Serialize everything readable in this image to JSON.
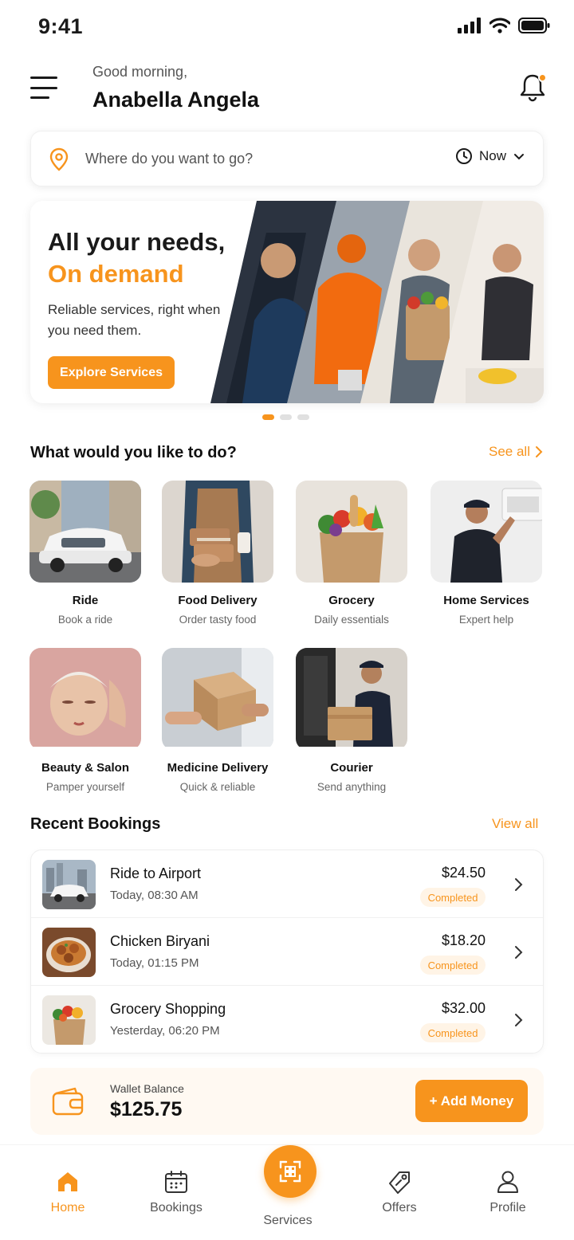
{
  "status_bar": {
    "time": "9:41"
  },
  "header": {
    "greeting": "Good morning,",
    "user_name": "Anabella Angela"
  },
  "search": {
    "placeholder": "Where do you want to go?",
    "time_option": "Now"
  },
  "hero": {
    "title_line1": "All your needs,",
    "title_line2": "On demand",
    "subtitle": "Reliable services, right when you need them.",
    "cta": "Explore Services"
  },
  "services_section": {
    "title": "What would you like to do?",
    "see_all": "See all"
  },
  "services": [
    {
      "name": "Ride",
      "desc": "Book a ride"
    },
    {
      "name": "Food Delivery",
      "desc": "Order tasty food"
    },
    {
      "name": "Grocery",
      "desc": "Daily essentials"
    },
    {
      "name": "Home Services",
      "desc": "Expert help"
    },
    {
      "name": "Beauty & Salon",
      "desc": "Pamper yourself"
    },
    {
      "name": "Medicine Delivery",
      "desc": "Quick & reliable"
    },
    {
      "name": "Courier",
      "desc": "Send anything"
    }
  ],
  "bookings_section": {
    "title": "Recent Bookings",
    "view_all": "View all"
  },
  "bookings": [
    {
      "title": "Ride to Airport",
      "time": "Today, 08:30 AM",
      "amount": "$24.50",
      "status": "Completed"
    },
    {
      "title": "Chicken Biryani",
      "time": "Today, 01:15 PM",
      "amount": "$18.20",
      "status": "Completed"
    },
    {
      "title": "Grocery Shopping",
      "time": "Yesterday, 06:20 PM",
      "amount": "$32.00",
      "status": "Completed"
    }
  ],
  "wallet": {
    "label": "Wallet Balance",
    "balance": "$125.75",
    "add_button": "+ Add Money"
  },
  "nav": [
    {
      "label": "Home",
      "icon": "home-icon",
      "active": true
    },
    {
      "label": "Bookings",
      "icon": "calendar-icon",
      "active": false
    },
    {
      "label": "Services",
      "icon": "services-grid-icon",
      "active": false
    },
    {
      "label": "Offers",
      "icon": "tag-icon",
      "active": false
    },
    {
      "label": "Profile",
      "icon": "user-icon",
      "active": false
    }
  ],
  "colors": {
    "accent": "#f7941d",
    "text": "#1a1a1a",
    "muted": "#666666"
  }
}
